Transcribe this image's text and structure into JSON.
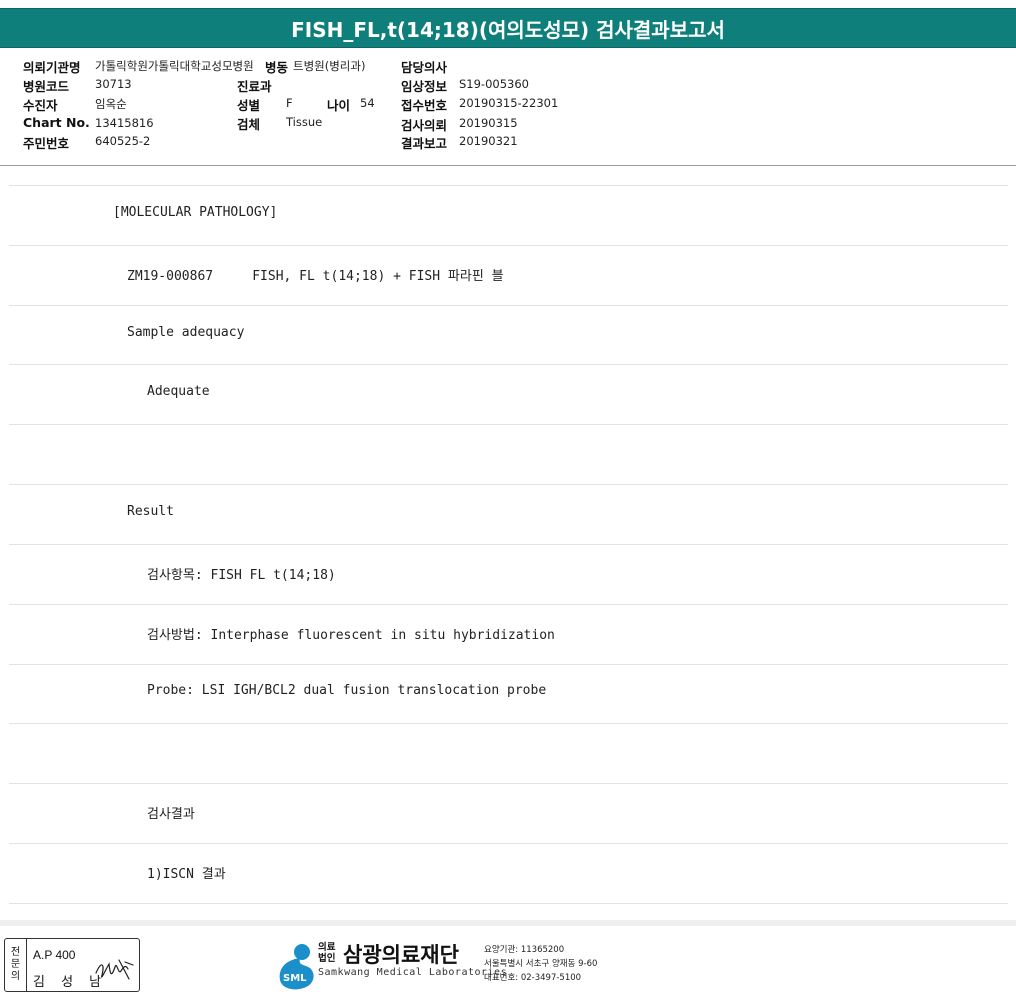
{
  "header": {
    "title": "FISH_FL,t(14;18)(여의도성모) 검사결과보고서"
  },
  "patient_info": {
    "institution_label": "의뢰기관명",
    "institution_value": "가톨릭학원가톨릭대학교성모병원",
    "ward_label": "병동",
    "ward_value": "트병원(병리과)",
    "attending_label": "담당의사",
    "attending_value": "",
    "hospital_code_label": "병원코드",
    "hospital_code_value": "30713",
    "department_label": "진료과",
    "department_value": "",
    "clinical_info_label": "임상정보",
    "clinical_info_value": "S19-005360",
    "patient_label": "수진자",
    "patient_value": "임옥순",
    "sex_label": "성별",
    "sex_value": "F",
    "age_label": "나이",
    "age_value": "54",
    "receipt_no_label": "접수번호",
    "receipt_no_value": "20190315-22301",
    "chart_no_label": "Chart No.",
    "chart_no_value": "13415816",
    "specimen_label": "검체",
    "specimen_value": "Tissue",
    "request_date_label": "검사의뢰",
    "request_date_value": "20190315",
    "id_no_label": "주민번호",
    "id_no_value": "640525-2",
    "report_date_label": "결과보고",
    "report_date_value": "20190321"
  },
  "report": {
    "lines": [
      "[MOLECULAR PATHOLOGY]",
      "ZM19-000867     FISH, FL t(14;18) + FISH 파라핀 블",
      "Sample adequacy",
      "Adequate",
      "",
      "Result",
      "검사항목: FISH FL t(14;18)",
      "검사방법: Interphase fluorescent in situ hybridization",
      "Probe: LSI IGH/BCL2 dual fusion translocation probe",
      "",
      "검사결과",
      "1)ISCN 결과"
    ]
  },
  "footer": {
    "sign_label_chars": [
      "전",
      "문",
      "의"
    ],
    "ap_text": "A.P 400",
    "doctor_name": "김 성 남",
    "org_prefix": "의료법인",
    "org_name": "삼광의료재단",
    "org_english": "Samkwang Medical Laboratories",
    "logo_text": "SML",
    "institution_code": "요양기관: 11365200",
    "address": "서울특별시 서초구 양재동 9-60",
    "phone": "대표번호: 02-3497-5100",
    "colors": {
      "brand_teal": "#0f7f7b",
      "logo_blue": "#1a8fc9"
    }
  }
}
